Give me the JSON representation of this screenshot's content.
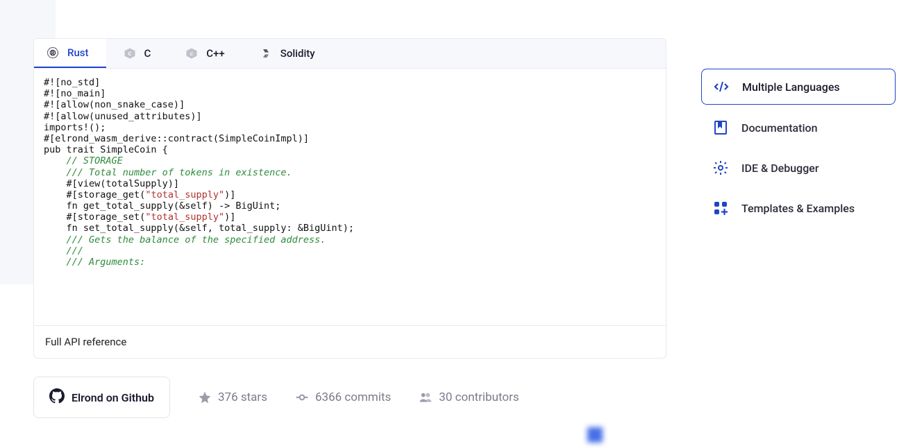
{
  "tabs": [
    {
      "label": "Rust"
    },
    {
      "label": "C"
    },
    {
      "label": "C++"
    },
    {
      "label": "Solidity"
    }
  ],
  "code": {
    "l1": "#![no_std]",
    "l2": "#![no_main]",
    "l3": "#![allow(non_snake_case)]",
    "l4": "#![allow(unused_attributes)]",
    "l5": "",
    "l6": "imports!();",
    "l7": "",
    "l8": "#[elrond_wasm_derive::contract(SimpleCoinImpl)]",
    "l9": "pub trait SimpleCoin {",
    "l10": "",
    "l11_pre": "    ",
    "l11": "// STORAGE",
    "l12": "",
    "l13_pre": "    ",
    "l13": "/// Total number of tokens in existence.",
    "l14": "    #[view(totalSupply)]",
    "l15a": "    #[storage_get(",
    "l15b": "\"total_supply\"",
    "l15c": ")]",
    "l16": "    fn get_total_supply(&self) -> BigUint;",
    "l17": "",
    "l18a": "    #[storage_set(",
    "l18b": "\"total_supply\"",
    "l18c": ")]",
    "l19": "    fn set_total_supply(&self, total_supply: &BigUint);",
    "l20": "",
    "l21_pre": "    ",
    "l21": "/// Gets the balance of the specified address.",
    "l22_pre": "    ",
    "l22": "///",
    "l23_pre": "    ",
    "l23": "/// Arguments:"
  },
  "footer": {
    "api_ref": "Full API reference"
  },
  "github": {
    "button": "Elrond on Github",
    "stars": "376 stars",
    "commits": "6366 commits",
    "contributors": "30 contributors"
  },
  "sidebar": {
    "items": [
      {
        "label": "Multiple Languages"
      },
      {
        "label": "Documentation"
      },
      {
        "label": "IDE & Debugger"
      },
      {
        "label": "Templates & Examples"
      }
    ]
  }
}
